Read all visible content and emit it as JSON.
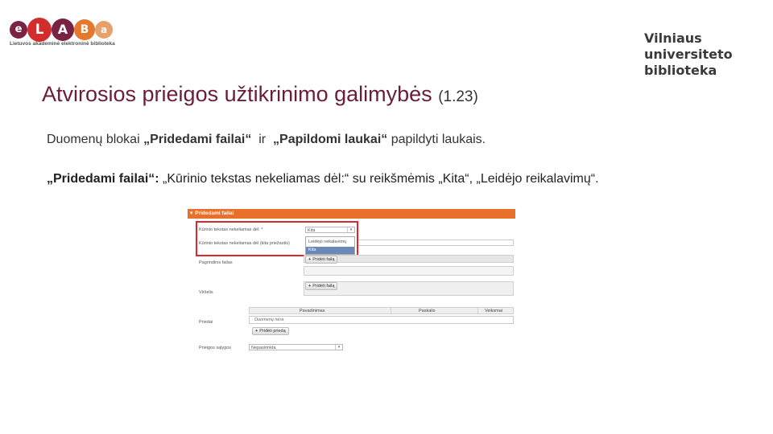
{
  "logo": {
    "letters": [
      "e",
      "L",
      "A",
      "B",
      "a"
    ],
    "colors": [
      "#7a2244",
      "#d22c2c",
      "#7a2244",
      "#e4792e",
      "#e8a06a"
    ],
    "subtitle": "Lietuvos akademinė elektroninė biblioteka"
  },
  "university_logo": {
    "lines": [
      "Vilniaus",
      "universiteto",
      "biblioteka"
    ]
  },
  "slide": {
    "title": "Atvirosios prieigos užtikrinimo galimybės",
    "title_number": "(1.23)",
    "para1_prefix": "Duomenų blokai ",
    "para1_bold1": "„Pridedami failai“",
    "para1_mid": "  ir  ",
    "para1_bold2": "„Papildomi laukai“",
    "para1_suffix": " papildyti laukais.",
    "para2_bold": "„Pridedami failai“:",
    "para2_text": " „Kūrinio tekstas nekeliamas dėl:“ su reikšmėmis „Kita“, „Leidėjo reikalavimų“."
  },
  "form": {
    "header": "Pridedami failai",
    "header_icon": "triangle-down-icon",
    "row_reason_label": "Kūrinio tekstas nekeliamas dėl: *",
    "reason_value": "Kita",
    "reason_options": [
      "Leidėjo reikalavimų",
      "Kita"
    ],
    "row_reason_other_label": "Kūrinio tekstas nekeliamas dėl (kita priežastis)",
    "row_main_file_label": "Pagrindinis failas",
    "upload_button": "Pridėti failą",
    "row_cover_label": "Viršelis",
    "add_file_button": "Pridėti failą",
    "attachments_label": "Priedai",
    "table_headers": [
      "Pavadinimas",
      "Paskalis",
      "Veiksmai"
    ],
    "attachment_placeholder": "Duomenų nėra",
    "add_attachment_button": "Pridėti priedą",
    "access_label": "Prieigos sąlygos",
    "access_value": "Nepasirinkta"
  }
}
